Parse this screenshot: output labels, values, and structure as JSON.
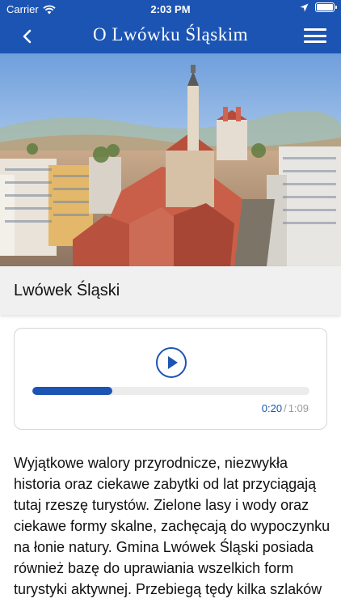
{
  "status_bar": {
    "carrier": "Carrier",
    "time": "2:03 PM"
  },
  "nav": {
    "title": "O Lwówku Śląskim",
    "back_icon": "chevron-left-icon",
    "menu_icon": "hamburger-menu-icon"
  },
  "place": {
    "name": "Lwówek Śląski"
  },
  "player": {
    "current_time": "0:20",
    "separator": "/",
    "total_time": "1:09",
    "progress_fraction": 0.29
  },
  "description": "Wyjątkowe walory przyrodnicze, niezwykła historia oraz ciekawe zabytki od lat przyciągają tutaj rzeszę turystów. Zielone lasy i wody oraz ciekawe formy skalne, zachęcają do wypoczynku na łonie natury. Gmina Lwówek Śląski posiada również bazę do uprawiania wszelkich form turystyki aktywnej. Przebiegą tędy kilka szlaków",
  "colors": {
    "brand_blue": "#1c54b4",
    "muted_gray": "#9a9a9a"
  }
}
